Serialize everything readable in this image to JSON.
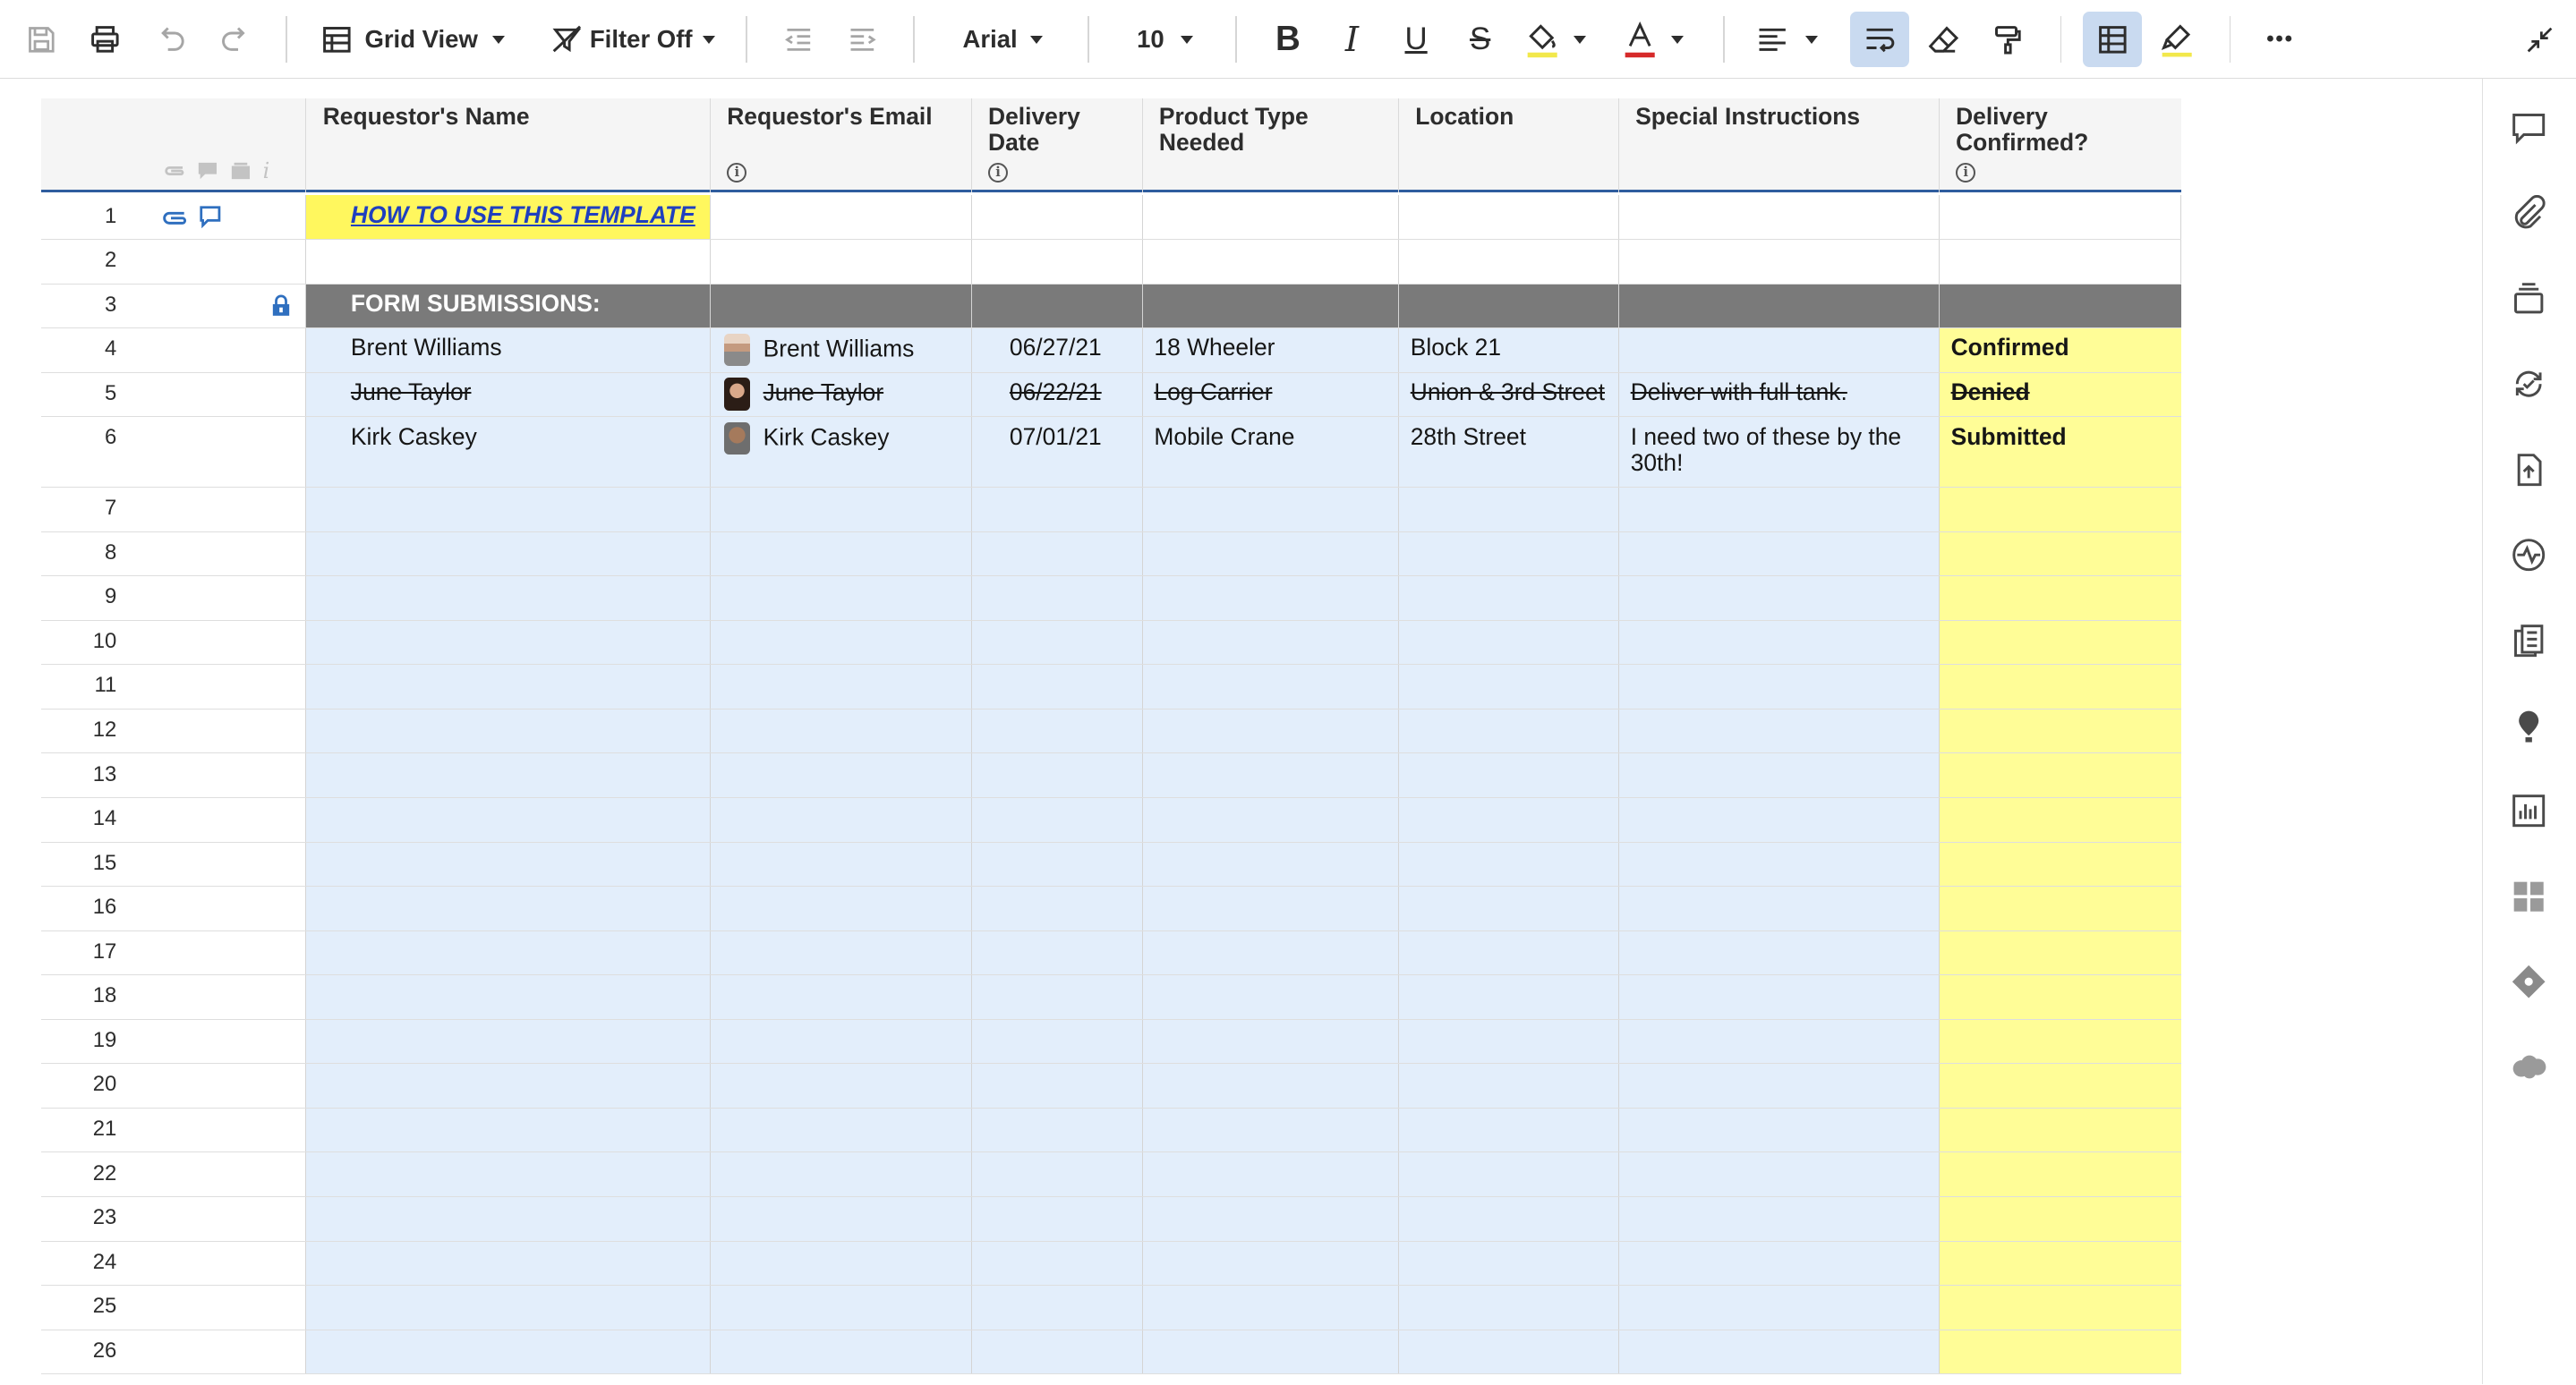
{
  "toolbar": {
    "view_label": "Grid View",
    "filter_label": "Filter Off",
    "font_family": "Arial",
    "font_size": "10",
    "more_glyph": "•••"
  },
  "columns": [
    {
      "label": "Requestor's Name",
      "info": false
    },
    {
      "label": "Requestor's Email",
      "info": true
    },
    {
      "label": "Delivery Date",
      "info": true
    },
    {
      "label": "Product Type Needed",
      "info": false
    },
    {
      "label": "Location",
      "info": false
    },
    {
      "label": "Special Instructions",
      "info": false
    },
    {
      "label": "Delivery Confirmed?",
      "info": true
    }
  ],
  "row1": {
    "num": "1",
    "link_text": "HOW TO USE THIS TEMPLATE"
  },
  "row2": {
    "num": "2"
  },
  "row3": {
    "num": "3",
    "section_label": "FORM SUBMISSIONS:"
  },
  "rows": [
    {
      "num": "4",
      "name": "Brent Williams",
      "email": "Brent Williams",
      "date": "06/27/21",
      "product": "18 Wheeler",
      "location": "Block 21",
      "instructions": "",
      "status": "Confirmed",
      "struck": false
    },
    {
      "num": "5",
      "name": "June Taylor",
      "email": "June Taylor",
      "date": "06/22/21",
      "product": "Log Carrier",
      "location": "Union & 3rd Street",
      "instructions": "Deliver with full tank.",
      "status": "Denied",
      "struck": true
    },
    {
      "num": "6",
      "name": "Kirk Caskey",
      "email": "Kirk Caskey",
      "date": "07/01/21",
      "product": "Mobile Crane",
      "location": "28th Street",
      "instructions": "I need two of these by the 30th!",
      "status": "Submitted",
      "struck": false
    }
  ],
  "empty_rows": [
    "7",
    "8",
    "9",
    "10",
    "11",
    "12",
    "13",
    "14",
    "15",
    "16",
    "17",
    "18",
    "19",
    "20",
    "21",
    "22",
    "23",
    "24",
    "25",
    "26"
  ],
  "colors": {
    "row_highlight": "#e3eefb",
    "status_column": "#fffd97",
    "section_header": "#7a7a7a",
    "link": "#1f3fbf",
    "link_background": "#fff75e"
  },
  "icons": {
    "right_bar": [
      "comment-icon",
      "attachment-icon",
      "proofing-icon",
      "update-requests-icon",
      "publish-icon",
      "activity-log-icon",
      "forms-icon",
      "insights-icon",
      "reports-icon",
      "apps-icon",
      "connectors-icon",
      "salesforce-icon"
    ]
  }
}
